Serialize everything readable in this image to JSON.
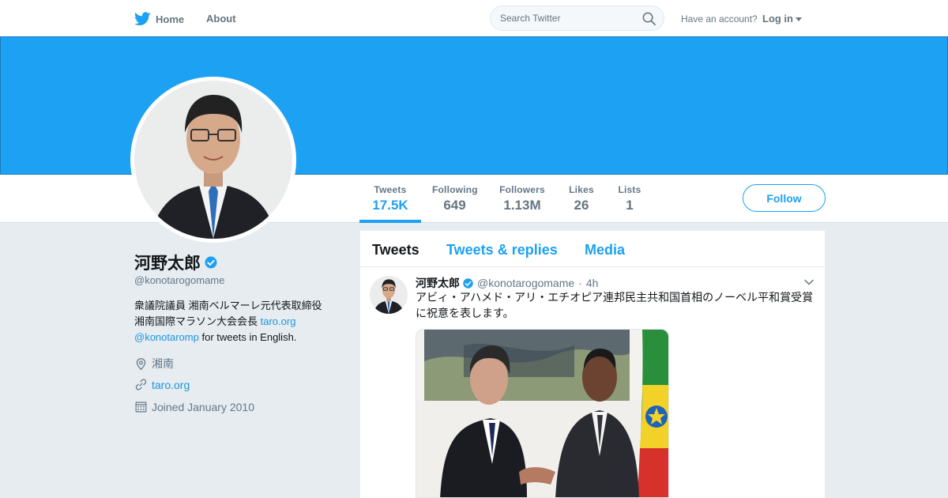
{
  "nav": {
    "home_label": "Home",
    "about_label": "About",
    "search_placeholder": "Search Twitter",
    "account_question": "Have an account?",
    "login_label": "Log in"
  },
  "stats": [
    {
      "label": "Tweets",
      "value": "17.5K"
    },
    {
      "label": "Following",
      "value": "649"
    },
    {
      "label": "Followers",
      "value": "1.13M"
    },
    {
      "label": "Likes",
      "value": "26"
    },
    {
      "label": "Lists",
      "value": "1"
    }
  ],
  "follow_label": "Follow",
  "profile": {
    "name": "河野太郎",
    "handle": "@konotarogomame",
    "bio_line1": "衆議院議員 湘南ベルマーレ元代表取締役",
    "bio_line2_text": "湘南国際マラソン大会会長 ",
    "bio_line2_link": "taro.org",
    "bio_line3_link": "@konotaromp",
    "bio_line3_text": " for tweets in English.",
    "location": "湘南",
    "website": "taro.org",
    "joined": "Joined January 2010"
  },
  "tabs": [
    {
      "label": "Tweets"
    },
    {
      "label": "Tweets & replies"
    },
    {
      "label": "Media"
    }
  ],
  "tweet": {
    "name": "河野太郎",
    "handle": "@konotarogomame",
    "separator": "·",
    "time": "4h",
    "text": "アビィ・アハメド・アリ・エチオピア連邦民主共和国首相のノーベル平和賞受賞に祝意を表します。"
  },
  "colors": {
    "brand_blue": "#1da1f2",
    "link_blue": "#1b95e0",
    "page_bg": "#e6ecf0",
    "muted_text": "#657786"
  },
  "icons": [
    "twitter-bird-icon",
    "search-icon",
    "verified-badge-icon",
    "location-pin-icon",
    "link-icon",
    "calendar-icon",
    "chevron-down-icon"
  ]
}
